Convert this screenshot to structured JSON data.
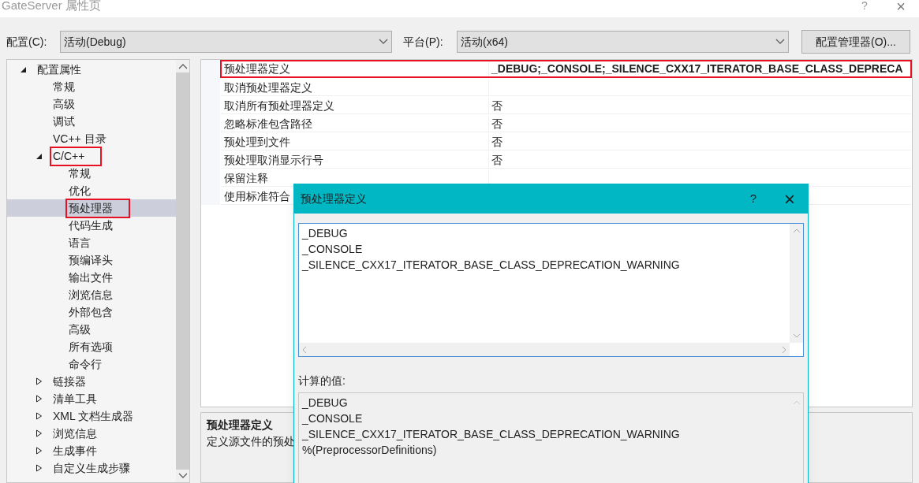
{
  "window": {
    "title": "GateServer 属性页",
    "help": "?",
    "close": "×"
  },
  "toolbar": {
    "config_label": "配置(C):",
    "config_value": "活动(Debug)",
    "platform_label": "平台(P):",
    "platform_value": "活动(x64)",
    "manager_button": "配置管理器(O)..."
  },
  "tree": [
    {
      "label": "配置属性",
      "expanded": true,
      "selected": false,
      "highlighted": false,
      "children": [
        {
          "label": "常规",
          "selected": false,
          "highlighted": false
        },
        {
          "label": "高级",
          "selected": false,
          "highlighted": false
        },
        {
          "label": "调试",
          "selected": false,
          "highlighted": false
        },
        {
          "label": "VC++ 目录",
          "selected": false,
          "highlighted": false
        },
        {
          "label": "C/C++",
          "expanded": true,
          "selected": false,
          "highlighted": true,
          "children": [
            {
              "label": "常规",
              "selected": false,
              "highlighted": false
            },
            {
              "label": "优化",
              "selected": false,
              "highlighted": false
            },
            {
              "label": "预处理器",
              "selected": true,
              "highlighted": true
            },
            {
              "label": "代码生成",
              "selected": false,
              "highlighted": false
            },
            {
              "label": "语言",
              "selected": false,
              "highlighted": false
            },
            {
              "label": "预编译头",
              "selected": false,
              "highlighted": false
            },
            {
              "label": "输出文件",
              "selected": false,
              "highlighted": false
            },
            {
              "label": "浏览信息",
              "selected": false,
              "highlighted": false
            },
            {
              "label": "外部包含",
              "selected": false,
              "highlighted": false
            },
            {
              "label": "高级",
              "selected": false,
              "highlighted": false
            },
            {
              "label": "所有选项",
              "selected": false,
              "highlighted": false
            },
            {
              "label": "命令行",
              "selected": false,
              "highlighted": false
            }
          ]
        },
        {
          "label": "链接器",
          "expanded": false,
          "selected": false,
          "highlighted": false
        },
        {
          "label": "清单工具",
          "expanded": false,
          "selected": false,
          "highlighted": false
        },
        {
          "label": "XML 文档生成器",
          "expanded": false,
          "selected": false,
          "highlighted": false
        },
        {
          "label": "浏览信息",
          "expanded": false,
          "selected": false,
          "highlighted": false
        },
        {
          "label": "生成事件",
          "expanded": false,
          "selected": false,
          "highlighted": false
        },
        {
          "label": "自定义生成步骤",
          "expanded": false,
          "selected": false,
          "highlighted": false
        }
      ]
    }
  ],
  "properties": [
    {
      "name": "预处理器定义",
      "value": "_DEBUG;_CONSOLE;_SILENCE_CXX17_ITERATOR_BASE_CLASS_DEPRECA",
      "highlighted": true
    },
    {
      "name": "取消预处理器定义",
      "highlighted": false
    },
    {
      "name": "取消所有预处理器定义",
      "value": "否",
      "highlighted": false
    },
    {
      "name": "忽略标准包含路径",
      "value": "否",
      "highlighted": false
    },
    {
      "name": "预处理到文件",
      "value": "否",
      "highlighted": false
    },
    {
      "name": "预处理取消显示行号",
      "value": "否",
      "highlighted": false
    },
    {
      "name": "保留注释",
      "highlighted": false
    },
    {
      "name": "使用标准符合",
      "highlighted": false
    }
  ],
  "description": {
    "title": "预处理器定义",
    "text": "定义源文件的预处"
  },
  "dialog": {
    "title": "预处理器定义",
    "help": "?",
    "close": "×",
    "lines": [
      "_DEBUG",
      "_CONSOLE",
      "_SILENCE_CXX17_ITERATOR_BASE_CLASS_DEPRECATION_WARNING"
    ],
    "computed_label": "计算的值:",
    "computed_lines": [
      "_DEBUG",
      "_CONSOLE",
      "_SILENCE_CXX17_ITERATOR_BASE_CLASS_DEPRECATION_WARNING",
      "%(PreprocessorDefinitions)"
    ]
  }
}
